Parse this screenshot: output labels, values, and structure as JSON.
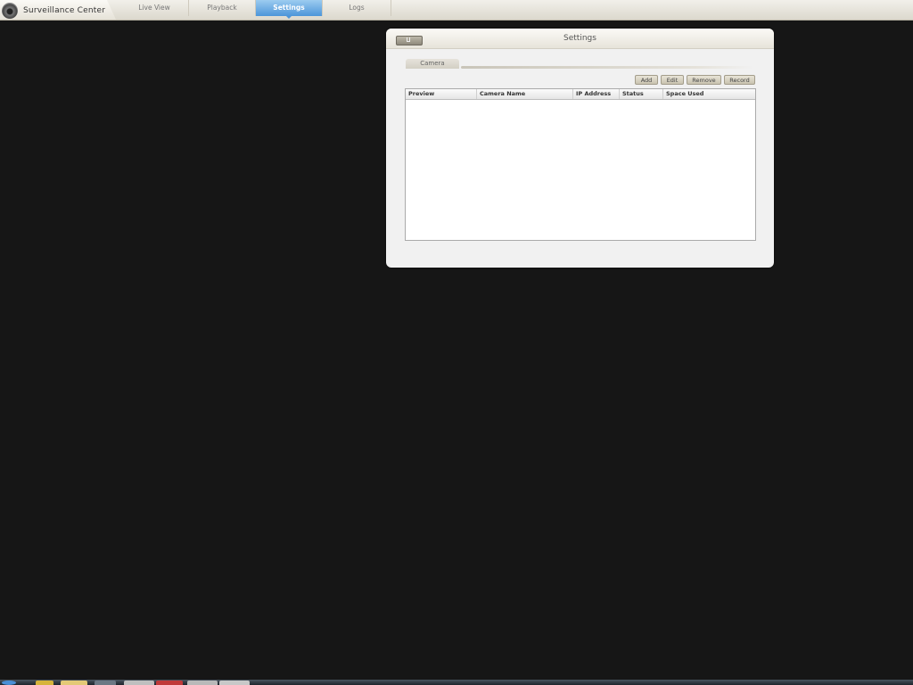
{
  "app": {
    "title": "Surveillance Center",
    "icon": "camera-icon"
  },
  "nav": {
    "tabs": [
      {
        "label": "Live View",
        "active": false
      },
      {
        "label": "Playback",
        "active": false
      },
      {
        "label": "Settings",
        "active": true
      },
      {
        "label": "Logs",
        "active": false
      }
    ]
  },
  "dialog": {
    "title": "Settings",
    "home_icon": "home-icon",
    "section_tab": "Camera",
    "buttons": {
      "add": "Add",
      "edit": "Edit",
      "remove": "Remove",
      "record": "Record"
    },
    "table": {
      "columns": [
        "Preview",
        "Camera Name",
        "IP Address",
        "Status",
        "Space Used"
      ],
      "rows": []
    }
  },
  "colors": {
    "accent": "#4d95d9",
    "background": "#161616",
    "panel": "#f1f1f1"
  }
}
